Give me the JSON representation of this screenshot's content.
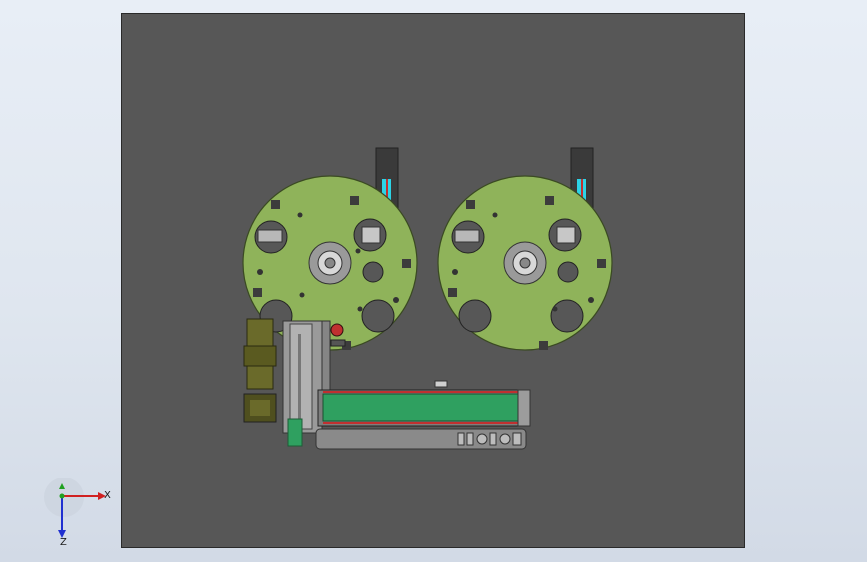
{
  "viewport": {
    "background": "#575757"
  },
  "model": {
    "disc_color": "#8fb35a",
    "belt_color": "#2fa060",
    "accent_red": "#c03030",
    "accent_cyan": "#2cd3e6",
    "motor_color": "#6a6a2a",
    "label_plate_text": "←□"
  },
  "triad": {
    "x_label": "X",
    "y_label": "Y",
    "z_label": "Z",
    "x_color": "#d02020",
    "y_color": "#20a020",
    "z_color": "#2030d0"
  }
}
